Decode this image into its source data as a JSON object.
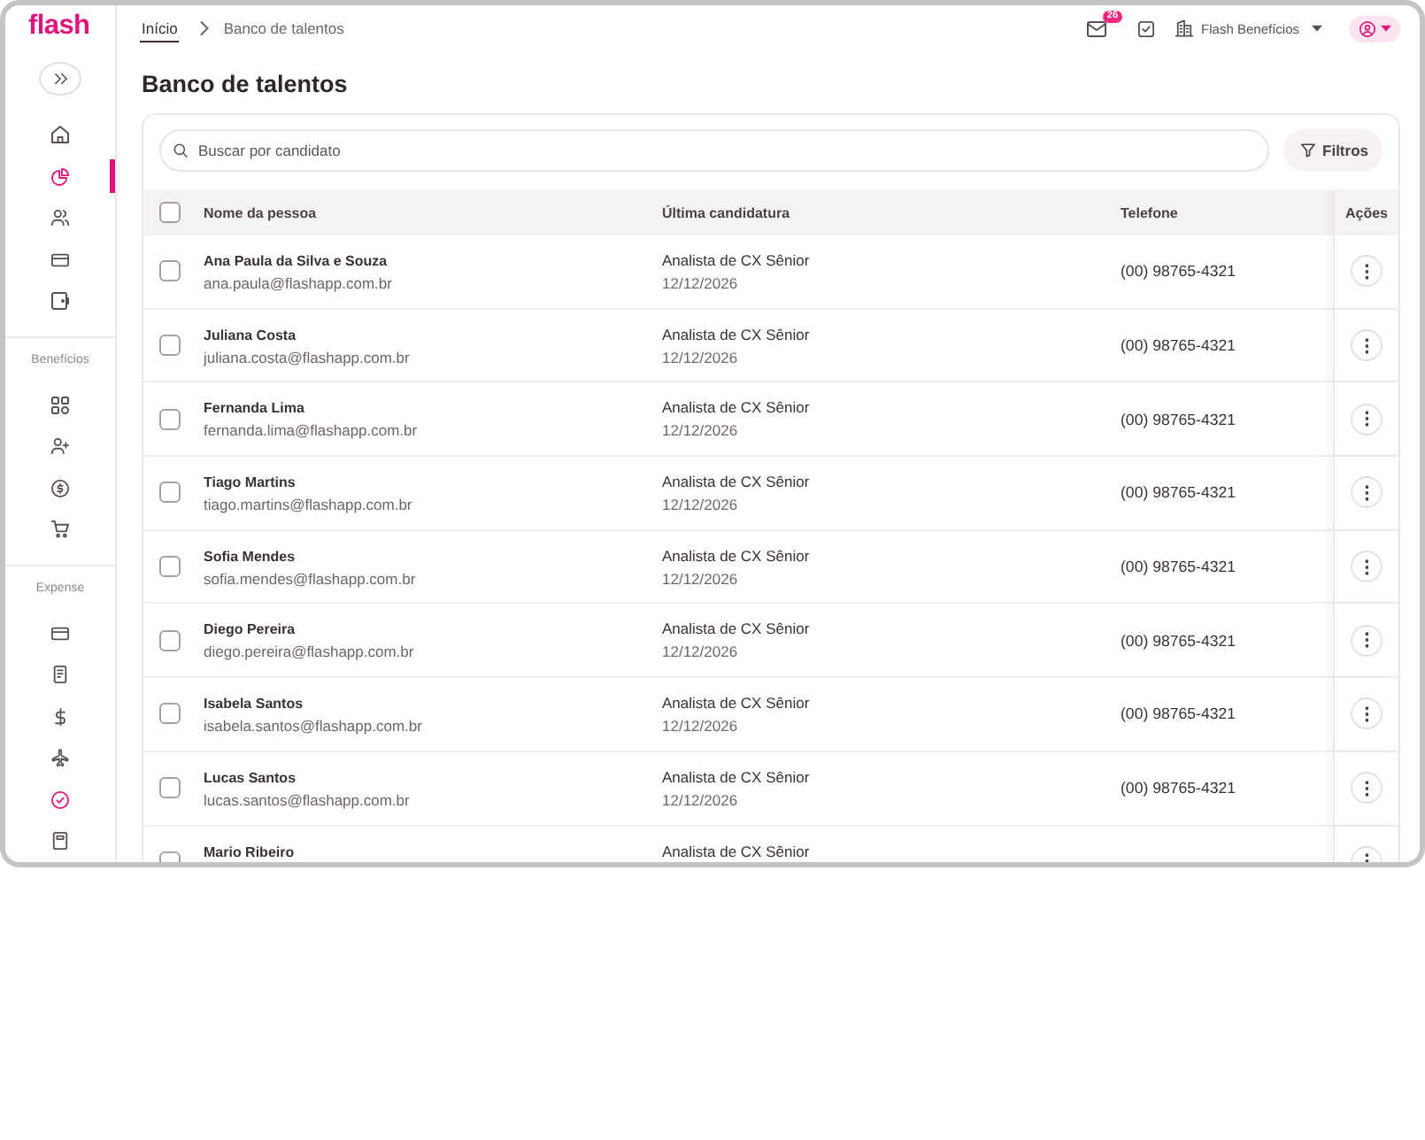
{
  "sidebar": {
    "logo": "flash",
    "sections": [
      {
        "items": [
          {
            "selected": false
          },
          {
            "selected": true
          },
          {
            "selected": false
          },
          {
            "selected": false
          },
          {
            "selected": false
          }
        ]
      },
      {
        "label": "Benefícios",
        "items": [
          {
            "selected": false
          },
          {
            "selected": false
          },
          {
            "selected": false
          },
          {
            "selected": false
          }
        ]
      },
      {
        "label": "Expense",
        "items": [
          {
            "selected": false
          },
          {
            "selected": false
          },
          {
            "selected": false
          },
          {
            "selected": false
          },
          {
            "selected": false,
            "color": "#e0147c"
          },
          {
            "selected": false
          }
        ]
      }
    ]
  },
  "topbar": {
    "breadcrumb": [
      {
        "label": "Início"
      },
      {
        "label": "Banco de talentos"
      }
    ],
    "notification_count": "26",
    "company": "Flash Benefícios"
  },
  "page_title": "Banco de talentos",
  "search": {
    "placeholder": "Buscar por candidato"
  },
  "filter_button": "Filtros",
  "table": {
    "select_all": {
      "checked": false
    },
    "columns": [
      "Nome da pessoa",
      "Última candidatura",
      "Telefone",
      "Ações"
    ],
    "rows": [
      {
        "checked": false,
        "name": "Ana Paula da Silva e Souza",
        "email": "ana.paula@flashapp.com.br",
        "position": "Analista de CX Sênior",
        "date": "12/12/2026",
        "phone": "(00) 98765-4321"
      },
      {
        "checked": false,
        "name": "Juliana Costa",
        "email": "juliana.costa@flashapp.com.br",
        "position": "Analista de CX Sênior",
        "date": "12/12/2026",
        "phone": "(00) 98765-4321"
      },
      {
        "checked": false,
        "name": "Fernanda Lima",
        "email": "fernanda.lima@flashapp.com.br",
        "position": "Analista de CX Sênior",
        "date": "12/12/2026",
        "phone": "(00) 98765-4321"
      },
      {
        "checked": false,
        "name": "Tiago Martins",
        "email": "tiago.martins@flashapp.com.br",
        "position": "Analista de CX Sênior",
        "date": "12/12/2026",
        "phone": "(00) 98765-4321"
      },
      {
        "checked": false,
        "name": "Sofia Mendes",
        "email": "sofia.mendes@flashapp.com.br",
        "position": "Analista de CX Sênior",
        "date": "12/12/2026",
        "phone": "(00) 98765-4321"
      },
      {
        "checked": false,
        "name": "Diego Pereira",
        "email": "diego.pereira@flashapp.com.br",
        "position": "Analista de CX Sênior",
        "date": "12/12/2026",
        "phone": "(00) 98765-4321"
      },
      {
        "checked": false,
        "name": "Isabela Santos",
        "email": "isabela.santos@flashapp.com.br",
        "position": "Analista de CX Sênior",
        "date": "12/12/2026",
        "phone": "(00) 98765-4321"
      },
      {
        "checked": false,
        "name": "Lucas Santos",
        "email": "lucas.santos@flashapp.com.br",
        "position": "Analista de CX Sênior",
        "date": "12/12/2026",
        "phone": "(00) 98765-4321"
      },
      {
        "checked": false,
        "name": "Mario Ribeiro",
        "position": "Analista de CX Sênior"
      }
    ]
  }
}
